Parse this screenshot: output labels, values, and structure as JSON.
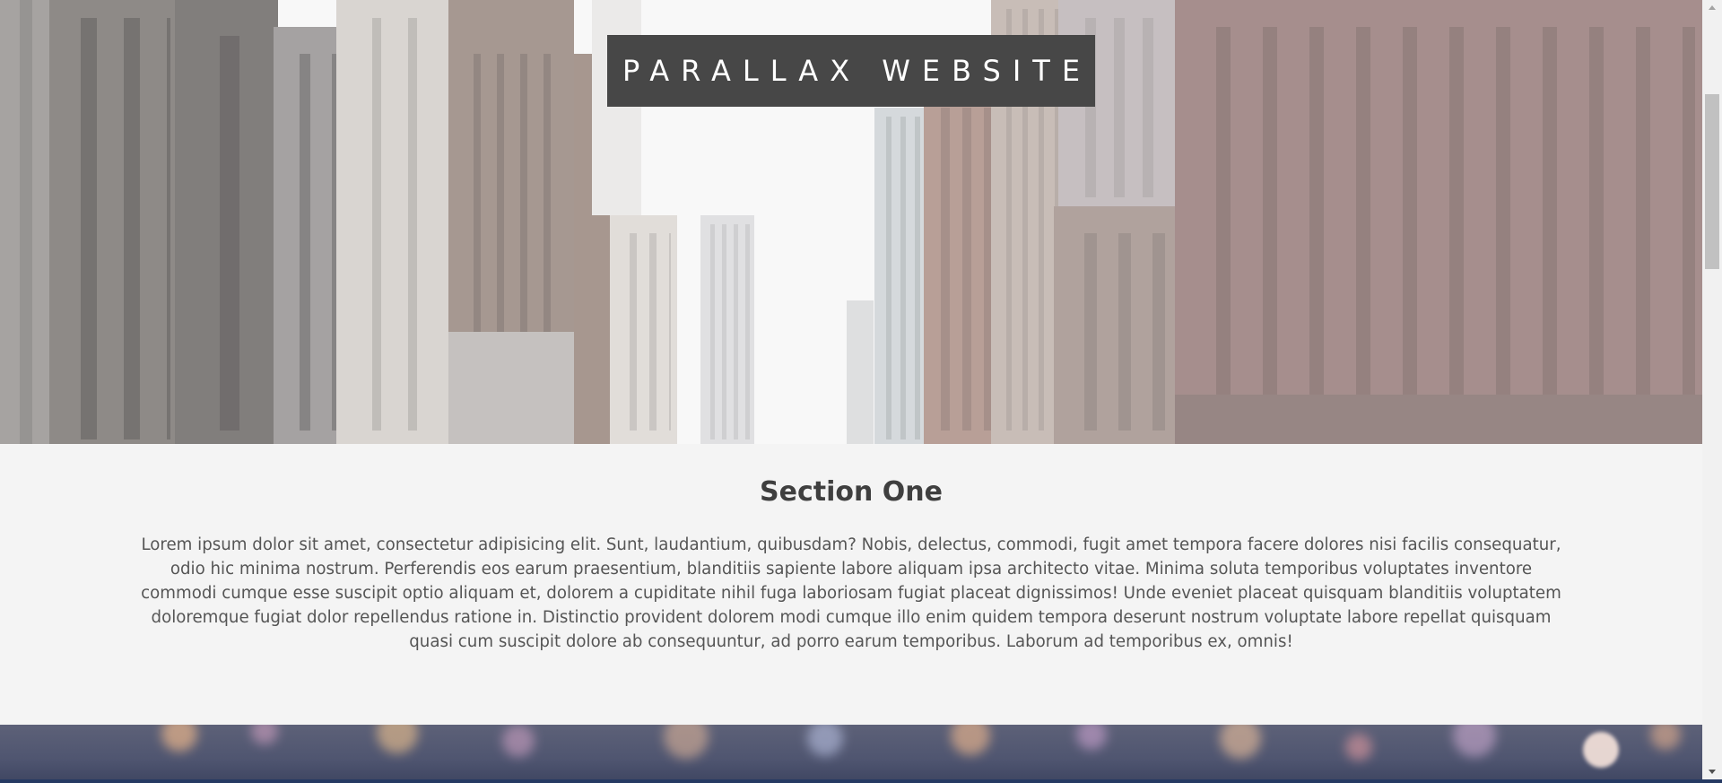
{
  "hero": {
    "title": "PARALLAX WEBSITE"
  },
  "section_one": {
    "heading": "Section One",
    "body": "Lorem ipsum dolor sit amet, consectetur adipisicing elit. Sunt, laudantium, quibusdam? Nobis, delectus, commodi, fugit amet tempora facere dolores nisi facilis consequatur, odio hic minima nostrum. Perferendis eos earum praesentium, blanditiis sapiente labore aliquam ipsa architecto vitae. Minima soluta temporibus voluptates inventore commodi cumque esse suscipit optio aliquam et, dolorem a cupiditate nihil fuga laboriosam fugiat placeat dignissimos! Unde eveniet placeat quisquam blanditiis voluptatem doloremque fugiat dolor repellendus ratione in. Distinctio provident dolorem modi cumque illo enim quidem tempora deserunt nostrum voluptate labore repellat quisquam quasi cum suscipit dolore ab consequuntur, ad porro earum temporibus. Laborum ad temporibus ex, omnis!"
  },
  "colors": {
    "title_box": "#474747",
    "section_bg": "#f4f4f4",
    "heading": "#3f3f3f",
    "body_text": "#555555"
  },
  "icons": {
    "scroll_up": "scroll-up-arrow-icon",
    "scroll_down": "scroll-down-arrow-icon"
  }
}
